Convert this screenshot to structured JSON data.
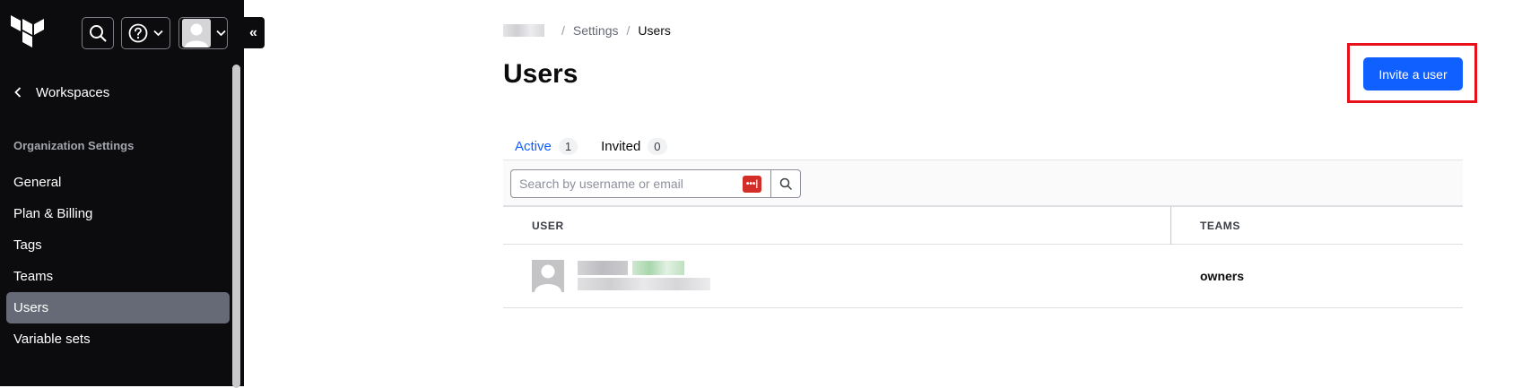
{
  "sidebar": {
    "back_label": "Workspaces",
    "section_heading": "Organization Settings",
    "items": [
      {
        "label": "General",
        "active": false
      },
      {
        "label": "Plan & Billing",
        "active": false
      },
      {
        "label": "Tags",
        "active": false
      },
      {
        "label": "Teams",
        "active": false
      },
      {
        "label": "Users",
        "active": true
      },
      {
        "label": "Variable sets",
        "active": false
      }
    ],
    "collapse_glyph": "«"
  },
  "breadcrumb": {
    "items": [
      "Settings",
      "Users"
    ]
  },
  "page": {
    "title": "Users",
    "invite_button": "Invite a user"
  },
  "tabs": [
    {
      "label": "Active",
      "count": "1",
      "active": true
    },
    {
      "label": "Invited",
      "count": "0",
      "active": false
    }
  ],
  "search": {
    "placeholder": "Search by username or email",
    "value": "",
    "password_manager_badge": "•••|"
  },
  "table": {
    "headers": [
      "USER",
      "TEAMS"
    ],
    "rows": [
      {
        "teams": "owners"
      }
    ]
  },
  "colors": {
    "accent": "#1060ff",
    "sidebar_bg": "#0c0c0e",
    "active_nav_bg": "#656a76",
    "highlight_border": "#e8101a"
  }
}
